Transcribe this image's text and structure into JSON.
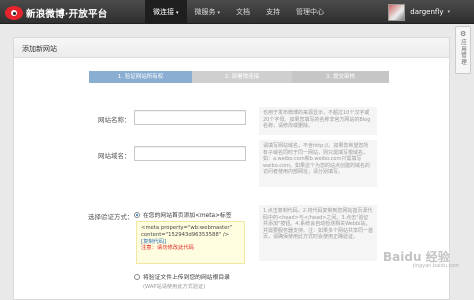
{
  "header": {
    "brand": "新浪微博·开放平台",
    "nav": [
      {
        "label": "微连接",
        "has_caret": true,
        "active": true
      },
      {
        "label": "微服务",
        "has_caret": true,
        "active": false
      },
      {
        "label": "文档",
        "has_caret": false,
        "active": false
      },
      {
        "label": "支持",
        "has_caret": false,
        "active": false
      },
      {
        "label": "管理中心",
        "has_caret": false,
        "active": false
      }
    ],
    "caret": "▾",
    "username": "dargenfly",
    "user_caret": "▾"
  },
  "side_tab": {
    "gear": "⚙",
    "label": "应用管理"
  },
  "panel": {
    "title": "添加新网站"
  },
  "steps": [
    "1. 验证网站所有权",
    "2. 部署微连接",
    "3. 提交审核"
  ],
  "form": {
    "site_name_label": "网站名称：",
    "site_name_value": "",
    "site_name_hint": "也用于发布微博的来源显示，不超过10个汉字或20个字母。如果您填写的名称非官方网站的Blog名称，请修改或删除。",
    "site_domain_label": "网站域名：",
    "site_domain_value": "",
    "site_domain_hint": "请填写网站域名，不含http://。如果您希望您所有子域名同时于同一网站，则只需填写根域名，如：a.weibo.com和b.weibo.com只需填写weibo.com。如果这个为您的站点创建的域名的访问者使用内部网址，请分别填写。",
    "verify_label": "选择验证方式：",
    "verify_option1": "在您的网站首页添加<meta>标签",
    "meta_line1": "<meta property=\"wb:webmaster\" content=\"152943d96353588\" />",
    "meta_copy": "[复制代码]",
    "meta_warn": "注意：请勿修改此代码",
    "verify_option2": "将验证文件上传到您的网站根目录",
    "verify_option2_note": "(WAP站请使用此方式验证)",
    "verify_hint": "1.点击复制代码。2.将代码复制到您网站首页源代码中的<head>与</head>之间。3.点击\"验证并添加\"按钮。4.系统会自动检测相关Webbi站，并需要服务器支持。注：如果多个网站共享同一首页，请确保使用此方式时会使用正确验证。"
  },
  "watermark": {
    "main": "Baidu 经验",
    "sub": "jingyan.baidu.com"
  }
}
